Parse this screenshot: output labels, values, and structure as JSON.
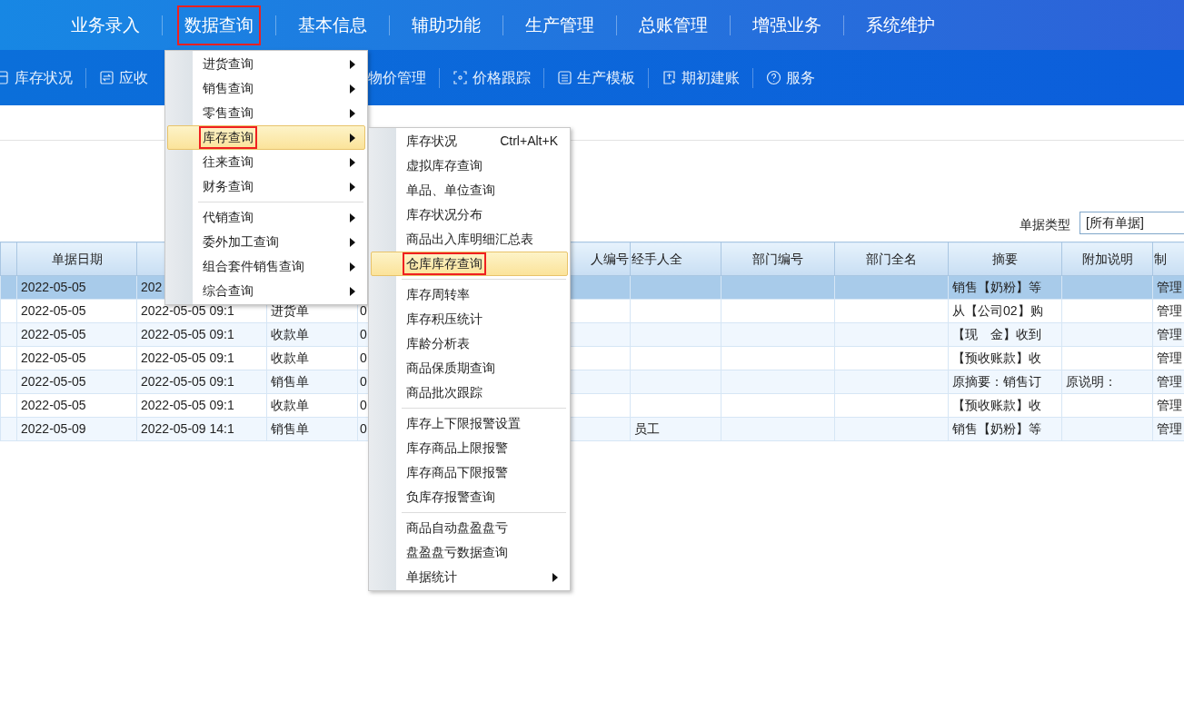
{
  "nav": [
    {
      "label": "业务录入",
      "annotated": false
    },
    {
      "label": "数据查询",
      "annotated": true
    },
    {
      "label": "基本信息",
      "annotated": false
    },
    {
      "label": "辅助功能",
      "annotated": false
    },
    {
      "label": "生产管理",
      "annotated": false
    },
    {
      "label": "总账管理",
      "annotated": false
    },
    {
      "label": "增强业务",
      "annotated": false
    },
    {
      "label": "系统维护",
      "annotated": false
    }
  ],
  "toolbar": {
    "left": [
      {
        "label": "库存状况"
      },
      {
        "label": "应收"
      }
    ],
    "right": [
      {
        "label": "物价管理"
      },
      {
        "label": "价格跟踪"
      },
      {
        "label": "生产模板"
      },
      {
        "label": "期初建账"
      },
      {
        "label": "服务"
      }
    ]
  },
  "filter": {
    "label": "单据类型",
    "value": "[所有单据]"
  },
  "table": {
    "columns": [
      {},
      {
        "label": "单据日期"
      },
      {},
      {},
      {
        "label": "人编号"
      },
      {
        "label": "经手人全"
      },
      {
        "label": "部门编号"
      },
      {
        "label": "部门全名"
      },
      {
        "label": "摘要"
      },
      {
        "label": "附加说明"
      },
      {
        "label": "制"
      }
    ],
    "rows": [
      {
        "selected": true,
        "cells": [
          null,
          "2022-05-05",
          "202",
          null,
          null,
          null,
          null,
          null,
          "销售【奶粉】等",
          null,
          "管理"
        ]
      },
      {
        "selected": false,
        "cells": [
          null,
          "2022-05-05",
          "2022-05-05 09:1",
          "进货单",
          "0",
          null,
          null,
          null,
          "从【公司02】购",
          null,
          "管理"
        ]
      },
      {
        "selected": false,
        "cells": [
          null,
          "2022-05-05",
          "2022-05-05 09:1",
          "收款单",
          "0",
          null,
          null,
          null,
          "【现　金】收到",
          null,
          "管理"
        ]
      },
      {
        "selected": false,
        "cells": [
          null,
          "2022-05-05",
          "2022-05-05 09:1",
          "收款单",
          "0",
          null,
          null,
          null,
          "【预收账款】收",
          null,
          "管理"
        ]
      },
      {
        "selected": false,
        "cells": [
          null,
          "2022-05-05",
          "2022-05-05 09:1",
          "销售单",
          "0",
          null,
          null,
          null,
          "原摘要：销售订",
          "原说明：",
          "管理"
        ]
      },
      {
        "selected": false,
        "cells": [
          null,
          "2022-05-05",
          "2022-05-05 09:1",
          "收款单",
          "0",
          null,
          null,
          null,
          "【预收账款】收",
          null,
          "管理"
        ]
      },
      {
        "selected": false,
        "cells": [
          null,
          "2022-05-09",
          "2022-05-09 14:1",
          "销售单",
          "0",
          "员工",
          null,
          null,
          "销售【奶粉】等",
          null,
          "管理"
        ]
      }
    ]
  },
  "menu": {
    "items": [
      {
        "kind": "item",
        "label": "进货查询",
        "submenu": true,
        "hovered": false,
        "annotated": false
      },
      {
        "kind": "item",
        "label": "销售查询",
        "submenu": true,
        "hovered": false,
        "annotated": false
      },
      {
        "kind": "item",
        "label": "零售查询",
        "submenu": true,
        "hovered": false,
        "annotated": false
      },
      {
        "kind": "item",
        "label": "库存查询",
        "submenu": true,
        "hovered": true,
        "annotated": true
      },
      {
        "kind": "item",
        "label": "往来查询",
        "submenu": true,
        "hovered": false,
        "annotated": false
      },
      {
        "kind": "item",
        "label": "财务查询",
        "submenu": true,
        "hovered": false,
        "annotated": false
      },
      {
        "kind": "separator"
      },
      {
        "kind": "item",
        "label": "代销查询",
        "submenu": true,
        "hovered": false,
        "annotated": false
      },
      {
        "kind": "item",
        "label": "委外加工查询",
        "submenu": true,
        "hovered": false,
        "annotated": false
      },
      {
        "kind": "item",
        "label": "组合套件销售查询",
        "submenu": true,
        "hovered": false,
        "annotated": false
      },
      {
        "kind": "item",
        "label": "综合查询",
        "submenu": true,
        "hovered": false,
        "annotated": false
      }
    ]
  },
  "submenu": {
    "items": [
      {
        "kind": "item",
        "label": "库存状况",
        "shortcut": "Ctrl+Alt+K",
        "submenu": false,
        "hovered": false,
        "annotated": false
      },
      {
        "kind": "item",
        "label": "虚拟库存查询",
        "submenu": false,
        "hovered": false,
        "annotated": false
      },
      {
        "kind": "item",
        "label": "单品、单位查询",
        "submenu": false,
        "hovered": false,
        "annotated": false
      },
      {
        "kind": "item",
        "label": "库存状况分布",
        "submenu": false,
        "hovered": false,
        "annotated": false
      },
      {
        "kind": "item",
        "label": "商品出入库明细汇总表",
        "submenu": false,
        "hovered": false,
        "annotated": false
      },
      {
        "kind": "item",
        "label": "仓库库存查询",
        "submenu": false,
        "hovered": true,
        "annotated": true
      },
      {
        "kind": "separator"
      },
      {
        "kind": "item",
        "label": "库存周转率",
        "submenu": false,
        "hovered": false,
        "annotated": false
      },
      {
        "kind": "item",
        "label": "库存积压统计",
        "submenu": false,
        "hovered": false,
        "annotated": false
      },
      {
        "kind": "item",
        "label": "库龄分析表",
        "submenu": false,
        "hovered": false,
        "annotated": false
      },
      {
        "kind": "item",
        "label": "商品保质期查询",
        "submenu": false,
        "hovered": false,
        "annotated": false
      },
      {
        "kind": "item",
        "label": "商品批次跟踪",
        "submenu": false,
        "hovered": false,
        "annotated": false
      },
      {
        "kind": "separator"
      },
      {
        "kind": "item",
        "label": "库存上下限报警设置",
        "submenu": false,
        "hovered": false,
        "annotated": false
      },
      {
        "kind": "item",
        "label": "库存商品上限报警",
        "submenu": false,
        "hovered": false,
        "annotated": false
      },
      {
        "kind": "item",
        "label": "库存商品下限报警",
        "submenu": false,
        "hovered": false,
        "annotated": false
      },
      {
        "kind": "item",
        "label": "负库存报警查询",
        "submenu": false,
        "hovered": false,
        "annotated": false
      },
      {
        "kind": "separator"
      },
      {
        "kind": "item",
        "label": "商品自动盘盈盘亏",
        "submenu": false,
        "hovered": false,
        "annotated": false
      },
      {
        "kind": "item",
        "label": "盘盈盘亏数据查询",
        "submenu": false,
        "hovered": false,
        "annotated": false
      },
      {
        "kind": "item",
        "label": "单据统计",
        "submenu": true,
        "hovered": false,
        "annotated": false
      }
    ]
  }
}
